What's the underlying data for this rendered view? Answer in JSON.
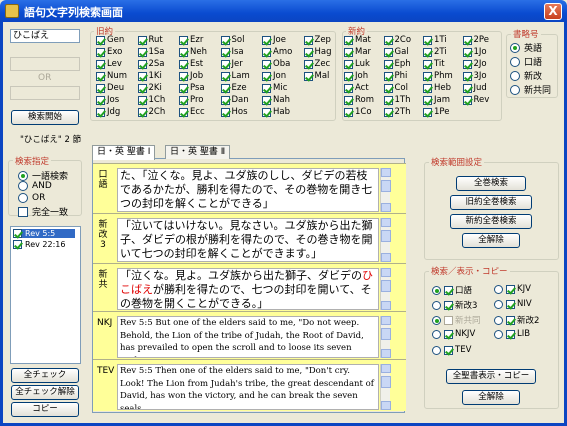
{
  "window": {
    "title": "語句文字列検索画面",
    "close": "X"
  },
  "search": {
    "keyword1": "ひこばえ",
    "or_label": "OR",
    "search_button": "検索開始",
    "result_count": "\"ひこばえ\" 2 節"
  },
  "search_spec": {
    "title": "検索指定",
    "options": [
      {
        "label": "一語検索",
        "selected": true
      },
      {
        "label": "AND",
        "selected": false
      },
      {
        "label": "OR",
        "selected": false
      }
    ],
    "exact_label": "完全一致",
    "exact": false
  },
  "results_list": [
    {
      "label": "Rev  5:5",
      "checked": true,
      "selected": true
    },
    {
      "label": "Rev  22:16",
      "checked": true,
      "selected": false
    }
  ],
  "bottom_buttons": {
    "check_all": "全チェック",
    "uncheck_all": "全チェック解除",
    "copy": "コピー"
  },
  "old_testament": {
    "title": "旧約",
    "books": [
      "Gen",
      "Exo",
      "Lev",
      "Num",
      "Deu",
      "Jos",
      "Jdg",
      "Rut",
      "1Sa",
      "2Sa",
      "1Ki",
      "2Ki",
      "1Ch",
      "2Ch",
      "Ezr",
      "Neh",
      "Est",
      "Job",
      "Psa",
      "Pro",
      "Ecc",
      "Sol",
      "Isa",
      "Jer",
      "Lam",
      "Eze",
      "Dan",
      "Hos",
      "Joe",
      "Amo",
      "Oba",
      "Jon",
      "Mic",
      "Nah",
      "Hab",
      "Zep",
      "Hag",
      "Zec",
      "Mal"
    ]
  },
  "new_testament": {
    "title": "新約",
    "books": [
      "Mat",
      "Mar",
      "Luk",
      "Joh",
      "Act",
      "Rom",
      "1Co",
      "2Co",
      "Gal",
      "Eph",
      "Phi",
      "Col",
      "1Th",
      "2Th",
      "1Ti",
      "2Ti",
      "Tit",
      "Phm",
      "Heb",
      "Jam",
      "1Pe",
      "2Pe",
      "1Jo",
      "2Jo",
      "3Jo",
      "Jud",
      "Rev"
    ]
  },
  "abbrev": {
    "title": "書略号",
    "options": [
      {
        "label": "英語",
        "selected": true
      },
      {
        "label": "口語",
        "selected": false
      },
      {
        "label": "新改",
        "selected": false
      },
      {
        "label": "新共同",
        "selected": false
      }
    ]
  },
  "tabs": [
    {
      "label": "日・英 聖書 Ⅰ",
      "active": true
    },
    {
      "label": "日・英 聖書 Ⅱ",
      "active": false
    }
  ],
  "verses": [
    {
      "label": "口語",
      "pre": "た、「泣くな。見よ、ユダ族のしし、ダビデの若枝であるかたが、勝利を得たので、その巻物を開き七つの封印を解くことができる」",
      "hl": "",
      "post": ""
    },
    {
      "label": "新改3",
      "pre": "「泣いてはいけない。見なさい。ユダ族から出た獅子、ダビデの根が勝利を得たので、その巻き物を開いて七つの封印を解くことができます。」",
      "hl": "",
      "post": ""
    },
    {
      "label": "新共",
      "pre": "「泣くな。見よ。ユダ族から出た獅子、ダビデの",
      "hl": "ひこばえ",
      "post": "が勝利を得たので、七つの封印を開いて、その巻物を開くことができる。」"
    },
    {
      "label": "NKJ",
      "pre": "Rev  5:5 But one of the elders said to me, \"Do not weep. Behold, the Lion of the tribe of Judah, the Root of David, has prevailed to open the scroll and to loose its seven seals.\"",
      "hl": "",
      "post": ""
    },
    {
      "label": "TEV",
      "pre": "Rev  5:5 Then one of the elders said to me, \"Don't cry. Look! The Lion from Judah's tribe, the great descendant of David, has won the victory, and he can break the seven seals",
      "hl": "",
      "post": ""
    }
  ],
  "range": {
    "title": "検索範囲設定",
    "buttons": [
      "全巻検索",
      "旧約全巻検索",
      "新約全巻検索",
      "全解除"
    ]
  },
  "display": {
    "title": "検索／表示・コピー",
    "versions": [
      {
        "label": "口語",
        "radio": true,
        "check": true
      },
      {
        "label": "KJV",
        "radio": false,
        "check": true
      },
      {
        "label": "新改3",
        "radio": false,
        "check": true
      },
      {
        "label": "NIV",
        "radio": false,
        "check": true
      },
      {
        "label": "新共同",
        "radio": true,
        "check": false,
        "disabled": true
      },
      {
        "label": "新改2",
        "radio": false,
        "check": true
      },
      {
        "label": "NKJV",
        "radio": false,
        "check": true
      },
      {
        "label": "LIB",
        "radio": false,
        "check": true
      },
      {
        "label": "TEV",
        "radio": false,
        "check": true
      }
    ],
    "buttons": [
      "全聖書表示・コピー",
      "全解除"
    ]
  }
}
